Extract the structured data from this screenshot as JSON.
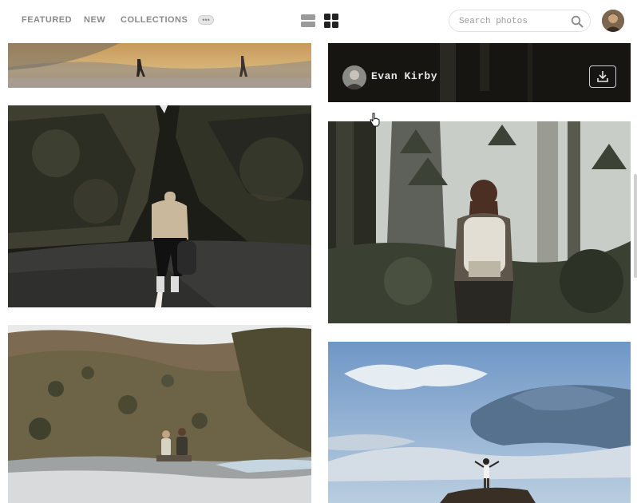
{
  "nav": {
    "featured": "FEATURED",
    "new": "NEW",
    "collections": "COLLECTIONS",
    "more": "•••"
  },
  "view": {
    "list_icon": "list-view-icon",
    "grid_icon": "grid-view-icon",
    "active": "grid"
  },
  "search": {
    "placeholder": "Search photos",
    "value": ""
  },
  "user": {
    "avatar_icon": "user-avatar"
  },
  "photos": {
    "left": [
      {
        "subject": "desert-walk"
      },
      {
        "subject": "canyon-road-hiker"
      },
      {
        "subject": "hillside-couple"
      }
    ],
    "right": [
      {
        "subject": "dark-forest",
        "author": "Evan Kirby",
        "download_icon": "download-icon"
      },
      {
        "subject": "forest-backpacker"
      },
      {
        "subject": "summit-sky"
      }
    ]
  },
  "colors": {
    "nav_text": "#8a8a8a",
    "author_bar": "#161512",
    "author_text": "#e8e8e8"
  }
}
